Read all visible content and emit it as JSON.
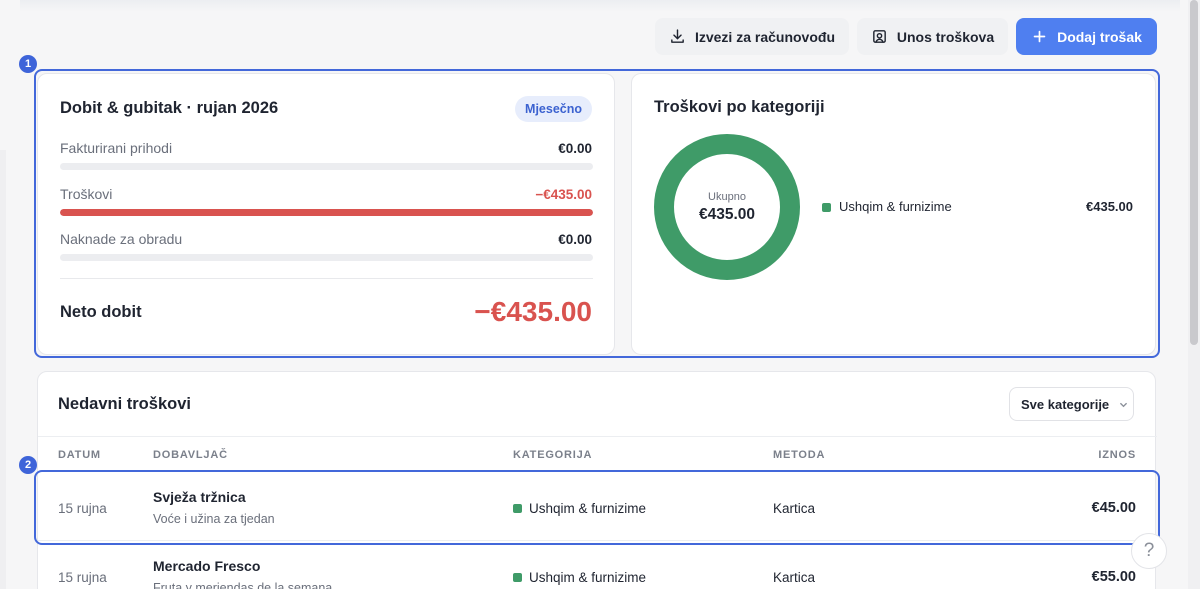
{
  "toolbar": {
    "export_label": "Izvezi za računovođu",
    "entry_label": "Unos troškova",
    "add_label": "Dodaj trošak"
  },
  "markers": [
    "1",
    "2"
  ],
  "pl": {
    "title": "Dobit & gubitak · rujan 2026",
    "period": "Mjesečno",
    "rows": [
      {
        "label": "Fakturirani prihodi",
        "value": "€0.00",
        "fill": 0
      },
      {
        "label": "Troškovi",
        "value": "−€435.00",
        "fill": 1.0
      },
      {
        "label": "Naknade za obradu",
        "value": "€0.00",
        "fill": 0
      }
    ],
    "net_label": "Neto dobit",
    "net_value": "−€435.00"
  },
  "categories": {
    "title": "Troškovi po kategoriji",
    "total_label": "Ukupno",
    "total_value": "€435.00",
    "legend": [
      {
        "name": "Ushqim & furnizime",
        "value": "€435.00",
        "color": "#3f9b68"
      }
    ]
  },
  "recent": {
    "title": "Nedavni troškovi",
    "filter": "Sve kategorije",
    "columns": [
      "DATUM",
      "DOBAVLJAČ",
      "KATEGORIJA",
      "METODA",
      "IZNOS"
    ],
    "rows": [
      {
        "date": "15 rujna",
        "vendor": "Svježa tržnica",
        "desc": "Voće i užina za tjedan",
        "category": "Ushqim & furnizime",
        "method": "Kartica",
        "amount": "€45.00"
      },
      {
        "date": "15 rujna",
        "vendor": "Mercado Fresco",
        "desc": "Fruta y meriendas de la semana",
        "category": "Ushqim & furnizime",
        "method": "Kartica",
        "amount": "€55.00"
      }
    ]
  },
  "help": {
    "label": "?"
  },
  "colors": {
    "accent": "#4f7ff0",
    "negative": "#d9534f",
    "category": "#3f9b68",
    "annotation": "#4368da"
  }
}
